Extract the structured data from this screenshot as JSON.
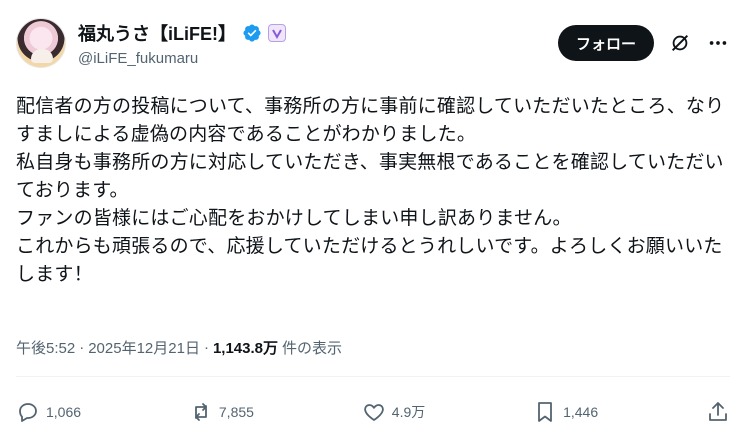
{
  "author": {
    "display_name": "福丸うさ【iLiFE!】",
    "handle": "@iLiFE_fukumaru"
  },
  "header": {
    "follow_label": "フォロー"
  },
  "post": {
    "lines": [
      "配信者の方の投稿について、事務所の方に事前に確認していただいたところ、なりすましによる虚偽の内容であることがわかりました。",
      "私自身も事務所の方に対応していただき、事実無根であることを確認していただいております。",
      "ファンの皆様にはご心配をおかけしてしまい申し訳ありません。",
      "これからも頑張るので、応援していただけるとうれしいです。よろしくお願いいたします！"
    ]
  },
  "meta": {
    "time": "午後5:52",
    "separator": "·",
    "date": "2025年12月21日",
    "separator2": "·",
    "views": "1,143.8万",
    "views_suffix": "件の表示"
  },
  "actions": {
    "replies": "1,066",
    "reposts": "7,855",
    "likes": "4.9万",
    "bookmarks": "1,446"
  },
  "colors": {
    "text": "#0f1419",
    "muted": "#536471",
    "verified": "#1d9bf0",
    "follow_bg": "#0f1419"
  },
  "icons": [
    "verified-icon",
    "affiliate-badge-icon",
    "grok-icon",
    "more-icon",
    "reply-icon",
    "repost-icon",
    "like-icon",
    "bookmark-icon",
    "share-icon"
  ]
}
